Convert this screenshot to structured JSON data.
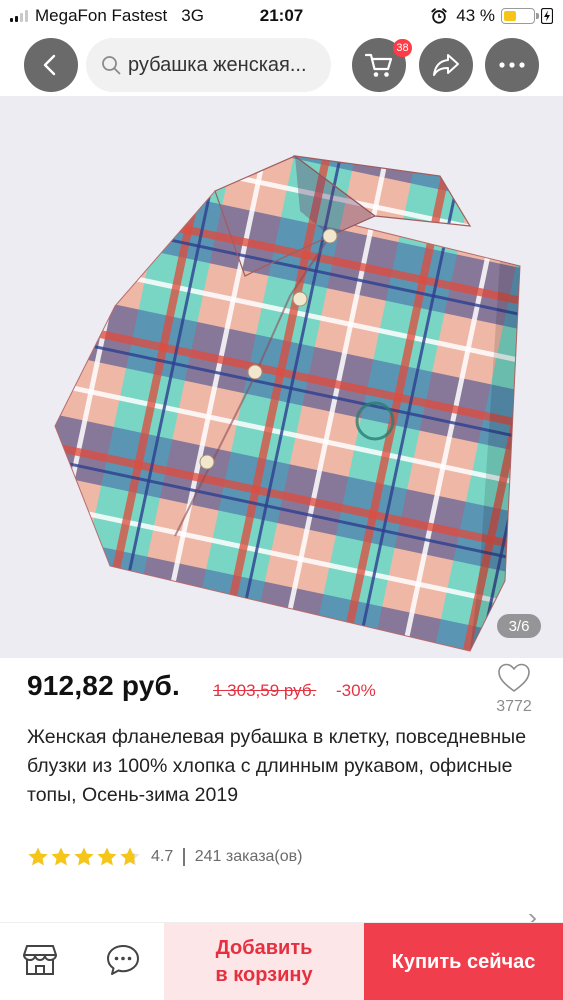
{
  "status_bar": {
    "carrier": "MegaFon Fastest",
    "network": "3G",
    "time": "21:07",
    "battery_percent": "43 %",
    "battery_level": 0.43,
    "signal_bars_active": 2,
    "battery_color": "#f5c518"
  },
  "nav": {
    "back_icon": "chevron-left-icon",
    "search_icon": "search-icon",
    "search_text": "рубашка женская...",
    "cart_icon": "cart-icon",
    "cart_badge": "38",
    "share_icon": "share-icon",
    "more_icon": "more-dots-icon"
  },
  "gallery": {
    "counter": "3/6",
    "image_description_icon": "product-photo"
  },
  "product": {
    "price": "912,82 руб.",
    "old_price": "1 303,59 руб.",
    "discount": "-30%",
    "wishlist_count": "3772",
    "title": "Женская фланелевая рубашка в клетку, повседневные блузки из 100% хлопка с длинным рукавом, офисные топы, Осень-зима 2019",
    "rating": {
      "stars": 4.7,
      "value": "4.7",
      "orders": "241 заказа(ов)"
    }
  },
  "bottom_bar": {
    "store_icon": "store-icon",
    "chat_icon": "chat-icon",
    "add_to_cart": "Добавить\nв корзину",
    "buy_now": "Купить сейчас"
  },
  "colors": {
    "accent": "#f03e4c",
    "accent_light": "#fde6e8",
    "price_strike": "#e43343",
    "star": "#f5c518",
    "nav_button": "#6a6a6a"
  }
}
